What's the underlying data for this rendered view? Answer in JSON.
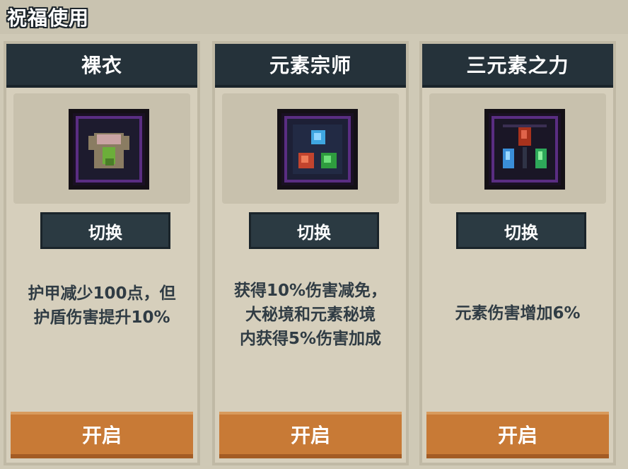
{
  "header": {
    "title": "祝福使用"
  },
  "cards": [
    {
      "title": "裸衣",
      "icon": "armor-shirt-icon",
      "switch_label": "切换",
      "description": "护甲减少100点，但\n护盾伤害提升10%",
      "open_label": "开启"
    },
    {
      "title": "元素宗师",
      "icon": "element-orbs-icon",
      "switch_label": "切换",
      "description": "获得10%伤害减免，\n大秘境和元素秘境\n内获得5%伤害加成",
      "open_label": "开启"
    },
    {
      "title": "三元素之力",
      "icon": "element-crystals-icon",
      "switch_label": "切换",
      "description": "元素伤害增加6%",
      "open_label": "开启"
    }
  ],
  "colors": {
    "header_bg": "#25323a",
    "accent_orange": "#c87a36",
    "panel_bg": "#d6cfbc",
    "icon_frame_purple": "#5a2d82"
  }
}
